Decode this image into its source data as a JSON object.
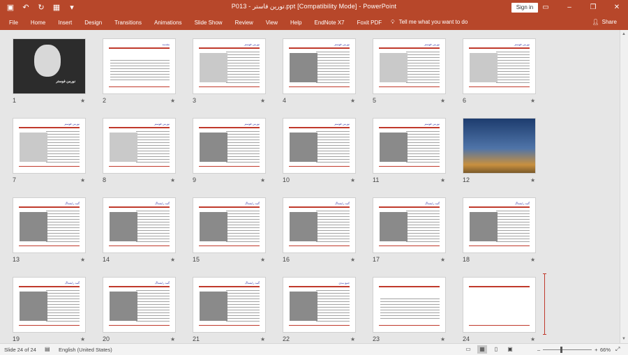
{
  "titlebar": {
    "title": "P013 - تورین فاستر.ppt [Compatibility Mode] - PowerPoint",
    "signin_label": "Sign in",
    "qat_icons": [
      "save-icon",
      "undo-icon",
      "redo-icon",
      "start-from-beginning-icon",
      "customize-qat-icon"
    ],
    "window_icons": [
      "ribbon-display-icon",
      "minimize-icon",
      "restore-icon",
      "close-icon"
    ]
  },
  "ribbon": {
    "tabs": [
      "File",
      "Home",
      "Insert",
      "Design",
      "Transitions",
      "Animations",
      "Slide Show",
      "Review",
      "View",
      "Help",
      "EndNote X7",
      "Foxit PDF"
    ],
    "tell_me": "Tell me what you want to do",
    "share": "Share"
  },
  "slides": [
    {
      "num": "1",
      "kind": "cover",
      "caption": "نورمن فوستر"
    },
    {
      "num": "2",
      "kind": "text",
      "header": "مقدمه"
    },
    {
      "num": "3",
      "kind": "portrait",
      "header": "نورمن فوستر"
    },
    {
      "num": "4",
      "kind": "picture",
      "header": "نورمن فوستر"
    },
    {
      "num": "5",
      "kind": "portrait",
      "header": "نورمن فوستر"
    },
    {
      "num": "6",
      "kind": "portrait",
      "header": "نورمن فوستر"
    },
    {
      "num": "7",
      "kind": "portrait",
      "header": "نورمن فوستر"
    },
    {
      "num": "8",
      "kind": "portrait",
      "header": "نورمن فوستر"
    },
    {
      "num": "9",
      "kind": "picture",
      "header": "نورمن فوستر"
    },
    {
      "num": "10",
      "kind": "picture",
      "header": "نورمن فوستر"
    },
    {
      "num": "11",
      "kind": "picture",
      "header": "نورمن فوستر"
    },
    {
      "num": "12",
      "kind": "dome",
      "header": ""
    },
    {
      "num": "13",
      "kind": "picture",
      "header": "گنبد رایشتاگ"
    },
    {
      "num": "14",
      "kind": "picture",
      "header": "گنبد رایشتاگ"
    },
    {
      "num": "15",
      "kind": "picture",
      "header": "گنبد رایشتاگ"
    },
    {
      "num": "16",
      "kind": "picture",
      "header": "گنبد رایشتاگ"
    },
    {
      "num": "17",
      "kind": "picture",
      "header": "گنبد رایشتاگ"
    },
    {
      "num": "18",
      "kind": "picture",
      "header": "گنبد رایشتاگ"
    },
    {
      "num": "19",
      "kind": "picture",
      "header": "گنبد رایشتاگ"
    },
    {
      "num": "20",
      "kind": "picture",
      "header": "گنبد رایشتاگ"
    },
    {
      "num": "21",
      "kind": "picture",
      "header": "گنبد رایشتاگ"
    },
    {
      "num": "22",
      "kind": "picture",
      "header": "جمع بندی"
    },
    {
      "num": "23",
      "kind": "text",
      "header": ""
    },
    {
      "num": "24",
      "kind": "blank",
      "header": ""
    }
  ],
  "statusbar": {
    "slide_info": "Slide 24 of 24",
    "language": "English (United States)",
    "zoom": "66%",
    "zoom_fraction": 0.36,
    "view_icons": [
      "normal-view-icon",
      "slide-sorter-view-icon",
      "reading-view-icon",
      "slideshow-view-icon"
    ]
  }
}
